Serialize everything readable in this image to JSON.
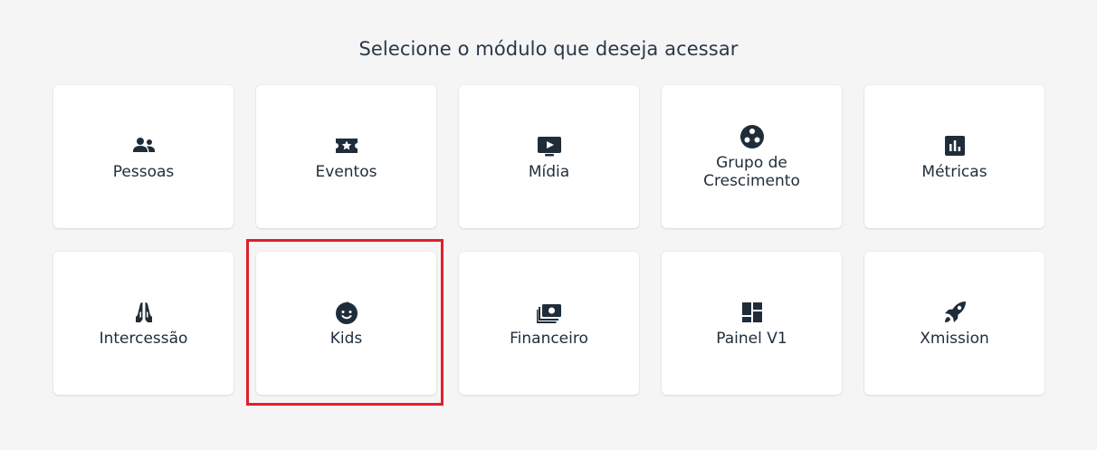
{
  "title": "Selecione o módulo que deseja acessar",
  "highlight_color": "#e0202a",
  "modules": [
    {
      "label": "Pessoas",
      "icon": "people-icon"
    },
    {
      "label": "Eventos",
      "icon": "ticket-icon"
    },
    {
      "label": "Mídia",
      "icon": "tv-play-icon"
    },
    {
      "label": "Grupo de Crescimento",
      "icon": "group-circle-icon"
    },
    {
      "label": "Métricas",
      "icon": "chart-icon"
    },
    {
      "label": "Intercessão",
      "icon": "praying-hands-icon"
    },
    {
      "label": "Kids",
      "icon": "baby-face-icon"
    },
    {
      "label": "Financeiro",
      "icon": "money-icon"
    },
    {
      "label": "Painel V1",
      "icon": "dashboard-icon"
    },
    {
      "label": "Xmission",
      "icon": "rocket-icon"
    }
  ]
}
